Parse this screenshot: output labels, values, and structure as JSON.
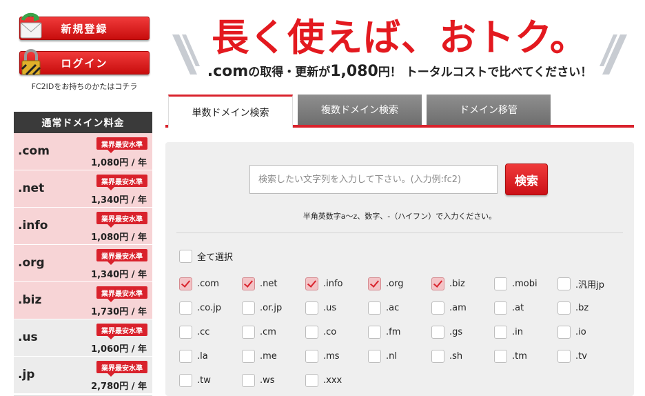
{
  "left": {
    "register_label": "新規登録",
    "login_label": "ログイン",
    "fc2_note": "FC2IDをお持ちのかたはコチラ",
    "price_table": {
      "title": "通常ドメイン料金",
      "badge": "業界最安水準",
      "rows": [
        {
          "tld": ".com",
          "price": "1,080円 / 年",
          "highlight": true
        },
        {
          "tld": ".net",
          "price": "1,340円 / 年",
          "highlight": true
        },
        {
          "tld": ".info",
          "price": "1,080円 / 年",
          "highlight": true
        },
        {
          "tld": ".org",
          "price": "1,340円 / 年",
          "highlight": true
        },
        {
          "tld": ".biz",
          "price": "1,730円 / 年",
          "highlight": true
        },
        {
          "tld": ".us",
          "price": "1,060円 / 年",
          "highlight": false
        },
        {
          "tld": ".jp",
          "price": "2,780円 / 年",
          "highlight": false
        }
      ]
    }
  },
  "banner": {
    "headline": "長く使えば、おトク。",
    "sub_a": ".com",
    "sub_b": "の取得・更新が",
    "sub_c": "1,080",
    "sub_d": "円！ トータルコストで比べてください！"
  },
  "tabs": [
    {
      "label": "単数ドメイン検索",
      "active": true
    },
    {
      "label": "複数ドメイン検索",
      "active": false
    },
    {
      "label": "ドメイン移管",
      "active": false
    }
  ],
  "search": {
    "placeholder": "検索したい文字列を入力して下さい。(入力例:fc2)",
    "button_label": "検索",
    "hint": "半角英数字a〜z、数字、-（ハイフン）で入力ください。",
    "select_all_label": "全て選択"
  },
  "tld_checkboxes": [
    {
      "label": ".com",
      "checked": true
    },
    {
      "label": ".net",
      "checked": true
    },
    {
      "label": ".info",
      "checked": true
    },
    {
      "label": ".org",
      "checked": true
    },
    {
      "label": ".biz",
      "checked": true
    },
    {
      "label": ".mobi",
      "checked": false
    },
    {
      "label": ".汎用jp",
      "checked": false
    },
    {
      "label": ".co.jp",
      "checked": false
    },
    {
      "label": ".or.jp",
      "checked": false
    },
    {
      "label": ".us",
      "checked": false
    },
    {
      "label": ".ac",
      "checked": false
    },
    {
      "label": ".am",
      "checked": false
    },
    {
      "label": ".at",
      "checked": false
    },
    {
      "label": ".bz",
      "checked": false
    },
    {
      "label": ".cc",
      "checked": false
    },
    {
      "label": ".cm",
      "checked": false
    },
    {
      "label": ".co",
      "checked": false
    },
    {
      "label": ".fm",
      "checked": false
    },
    {
      "label": ".gs",
      "checked": false
    },
    {
      "label": ".in",
      "checked": false
    },
    {
      "label": ".io",
      "checked": false
    },
    {
      "label": ".la",
      "checked": false
    },
    {
      "label": ".me",
      "checked": false
    },
    {
      "label": ".ms",
      "checked": false
    },
    {
      "label": ".nl",
      "checked": false
    },
    {
      "label": ".sh",
      "checked": false
    },
    {
      "label": ".tm",
      "checked": false
    },
    {
      "label": ".tv",
      "checked": false
    },
    {
      "label": ".tw",
      "checked": false
    },
    {
      "label": ".ws",
      "checked": false
    },
    {
      "label": ".xxx",
      "checked": false
    }
  ],
  "colors": {
    "accent": "#d9222c",
    "pink_row": "#f7d4d6",
    "grey_row": "#ececec"
  }
}
